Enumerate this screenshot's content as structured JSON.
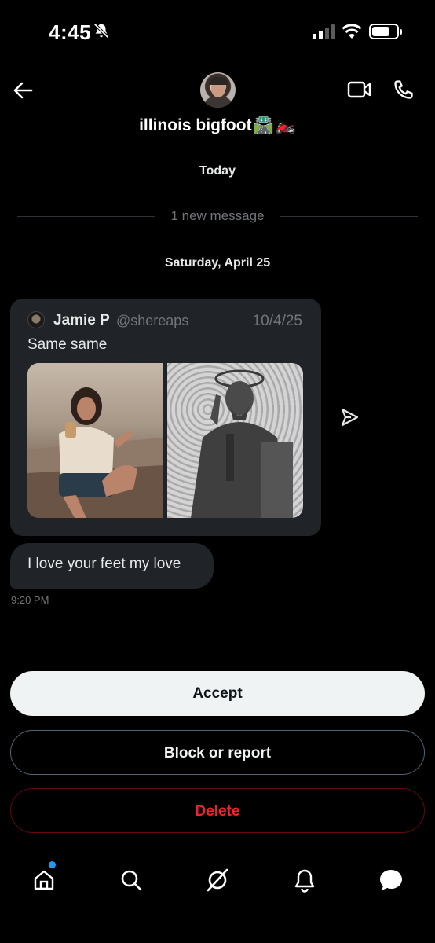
{
  "status_bar": {
    "time": "4:45",
    "silent_icon": "bell-slash-icon",
    "signal_icon": "cellular-signal-icon",
    "wifi_icon": "wifi-icon",
    "battery_icon": "battery-icon"
  },
  "header": {
    "back_icon": "arrow-left-icon",
    "contact_name": "illinois bigfoot",
    "name_emojis": [
      "🛣️",
      "🏍️"
    ],
    "video_icon": "video-camera-icon",
    "call_icon": "phone-icon"
  },
  "conversation": {
    "date_today": "Today",
    "new_message_divider": "1 new message",
    "date_saturday": "Saturday, April 25",
    "quoted_post": {
      "author_name": "Jamie P",
      "author_handle": "@shereaps",
      "date": "10/4/25",
      "text": "Same same",
      "images": [
        "photo-woman-with-coffee",
        "photo-statue-of-saint"
      ]
    },
    "share_icon": "share-arrow-icon",
    "message": {
      "text": "I love your feet my love",
      "time": "9:20 PM"
    }
  },
  "actions": {
    "accept_label": "Accept",
    "block_label": "Block or report",
    "delete_label": "Delete"
  },
  "bottom_nav": {
    "items": [
      {
        "icon": "home-icon",
        "has_badge": true
      },
      {
        "icon": "search-icon"
      },
      {
        "icon": "grok-icon"
      },
      {
        "icon": "bell-icon"
      },
      {
        "icon": "messages-icon",
        "active": true
      }
    ]
  },
  "colors": {
    "background": "#000000",
    "bubble": "#202327",
    "muted": "#71767b",
    "accent_blue": "#1d9bf0",
    "danger": "#f4212e"
  }
}
